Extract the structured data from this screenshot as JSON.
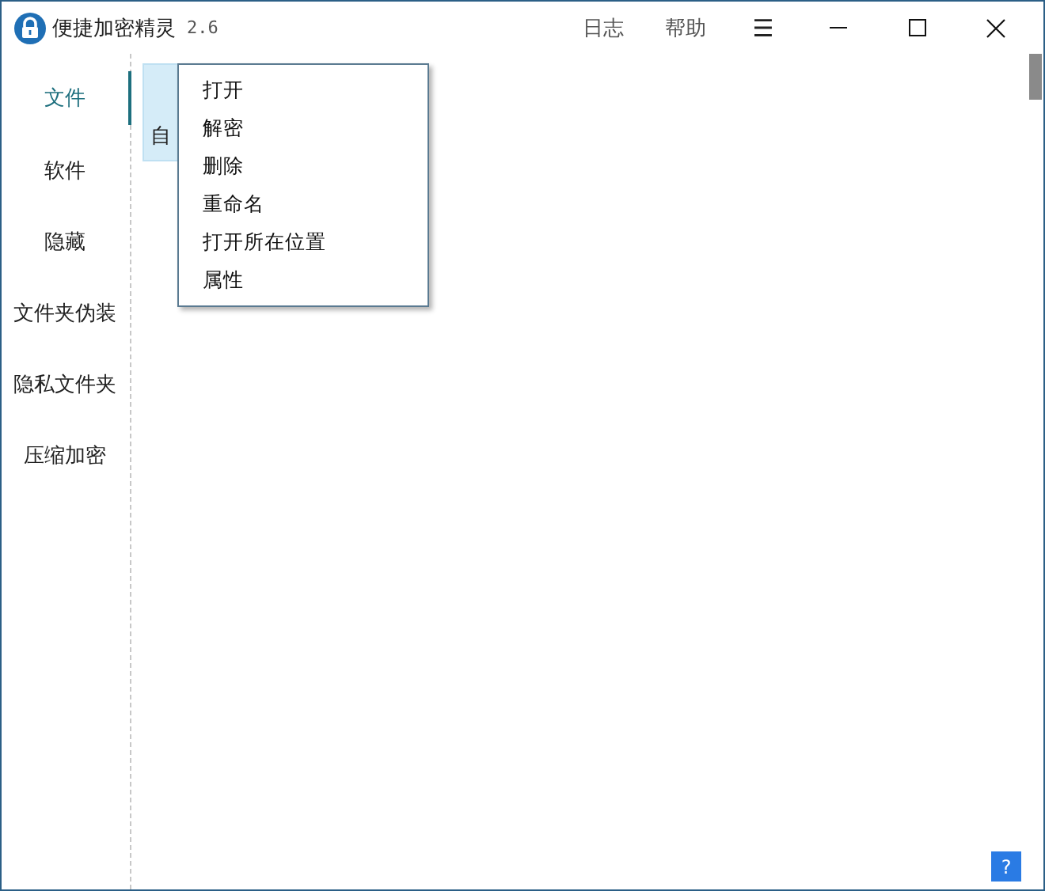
{
  "window": {
    "title": "便捷加密精灵",
    "version": "2.6"
  },
  "header_links": [
    "日志",
    "帮助"
  ],
  "menu_icon": "☰",
  "sidebar": {
    "items": [
      {
        "label": "文件",
        "selected": true
      },
      {
        "label": "软件",
        "selected": false
      },
      {
        "label": "隐藏",
        "selected": false
      },
      {
        "label": "文件夹伪装",
        "selected": false
      },
      {
        "label": "隐私文件夹",
        "selected": false
      },
      {
        "label": "压缩加密",
        "selected": false
      }
    ]
  },
  "files": [
    {
      "name": "自",
      "selected": true
    }
  ],
  "context_menu": [
    "打开",
    "解密",
    "删除",
    "重命名",
    "打开所在位置",
    "属性"
  ],
  "help_button": "?"
}
